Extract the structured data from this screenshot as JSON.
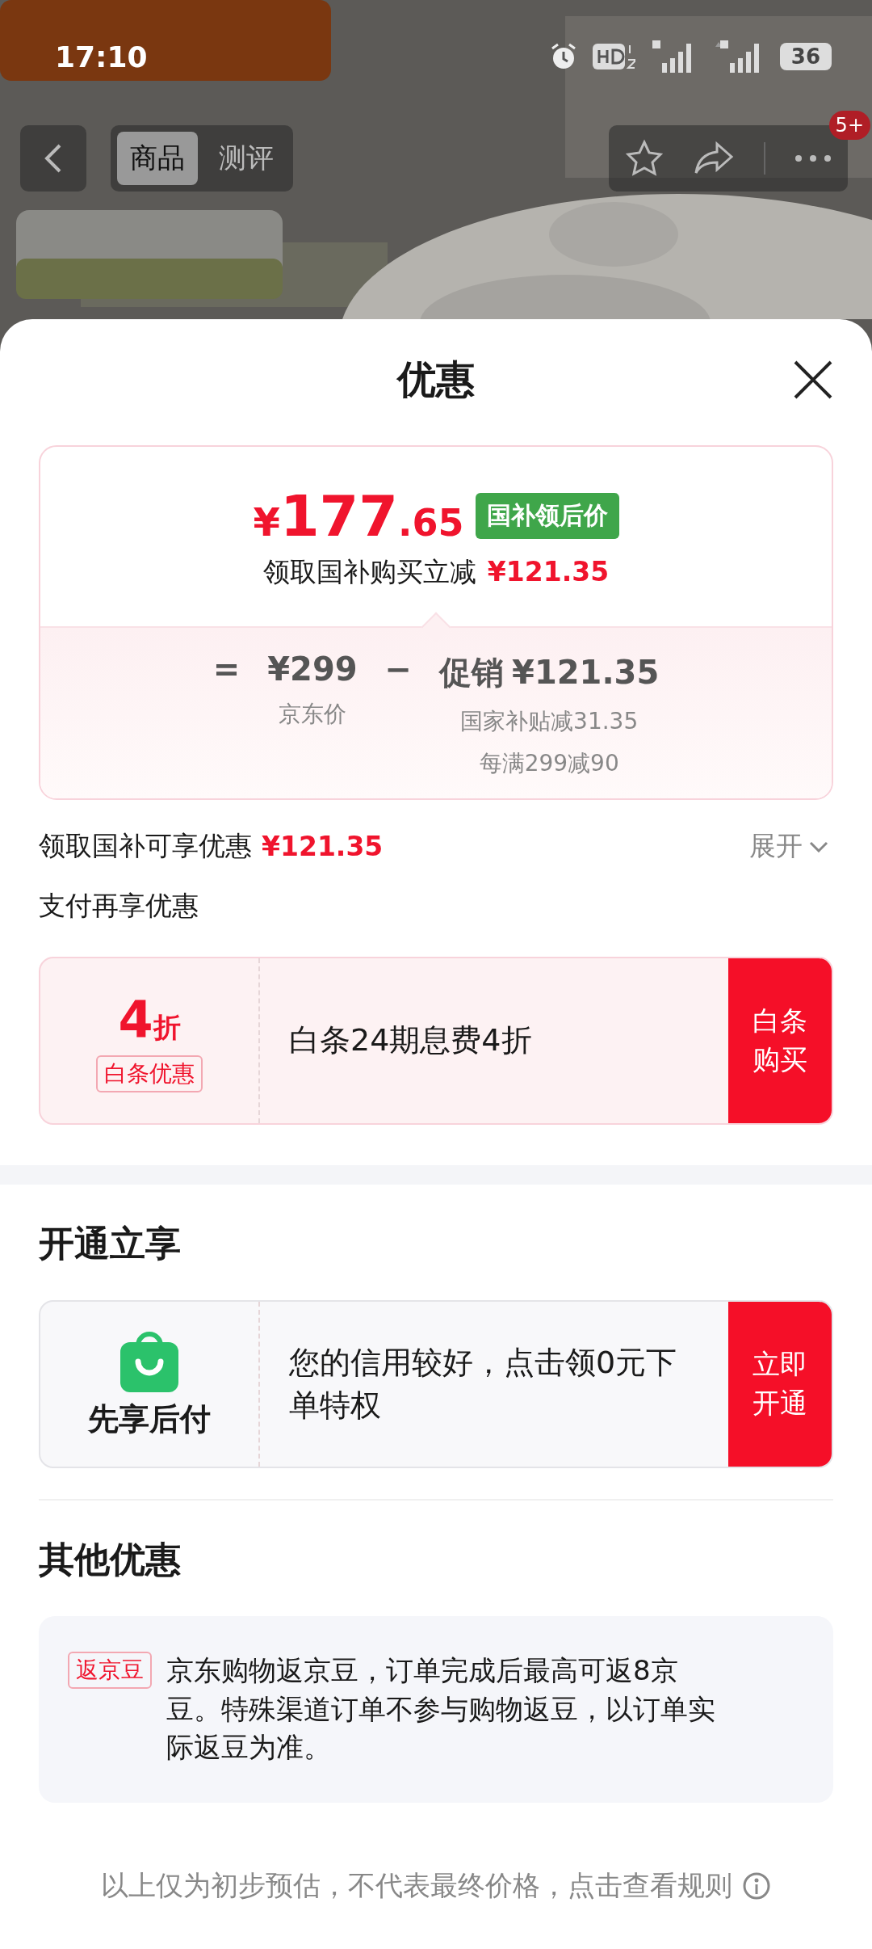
{
  "status_bar": {
    "time": "17:10",
    "battery": "36"
  },
  "nav": {
    "tabs": [
      {
        "label": "商品",
        "selected": true
      },
      {
        "label": "测评",
        "selected": false
      }
    ],
    "badge": "5+"
  },
  "sheet": {
    "title": "优惠",
    "price_card": {
      "currency": "¥",
      "price_int": "177",
      "price_dec": ".65",
      "tag": "国补领后价",
      "reduce_label": "领取国补购买立减",
      "reduce_amount": "¥121.35",
      "equals": "=",
      "base_price": "¥299",
      "base_label": "京东价",
      "minus": "−",
      "promo_label": "促销",
      "promo_amount": "¥121.35",
      "promo_details": [
        "国家补贴减31.35",
        "每满299减90"
      ]
    },
    "discount_row": {
      "label": "领取国补可享优惠",
      "amount": "¥121.35",
      "toggle": "展开"
    },
    "pay_title": "支付再享优惠",
    "pay_offers": [
      {
        "kind": "coupon",
        "value": "4",
        "unit": "折",
        "tag": "白条优惠",
        "text": "白条24期息费4折",
        "button": "白条购买"
      }
    ],
    "open_title": "开通立享",
    "open_offers": [
      {
        "kind": "service",
        "title": "先享后付",
        "text": "您的信用较好，点击领0元下单特权",
        "button": "立即开通"
      }
    ],
    "other_title": "其他优惠",
    "other_offers": [
      {
        "tag": "返京豆",
        "text": "京东购物返京豆，订单完成后最高可返8京豆。特殊渠道订单不参与购物返豆，以订单实际返豆为准。"
      }
    ],
    "footer": "以上仅为初步预估，不代表最终价格，点击查看规则"
  }
}
